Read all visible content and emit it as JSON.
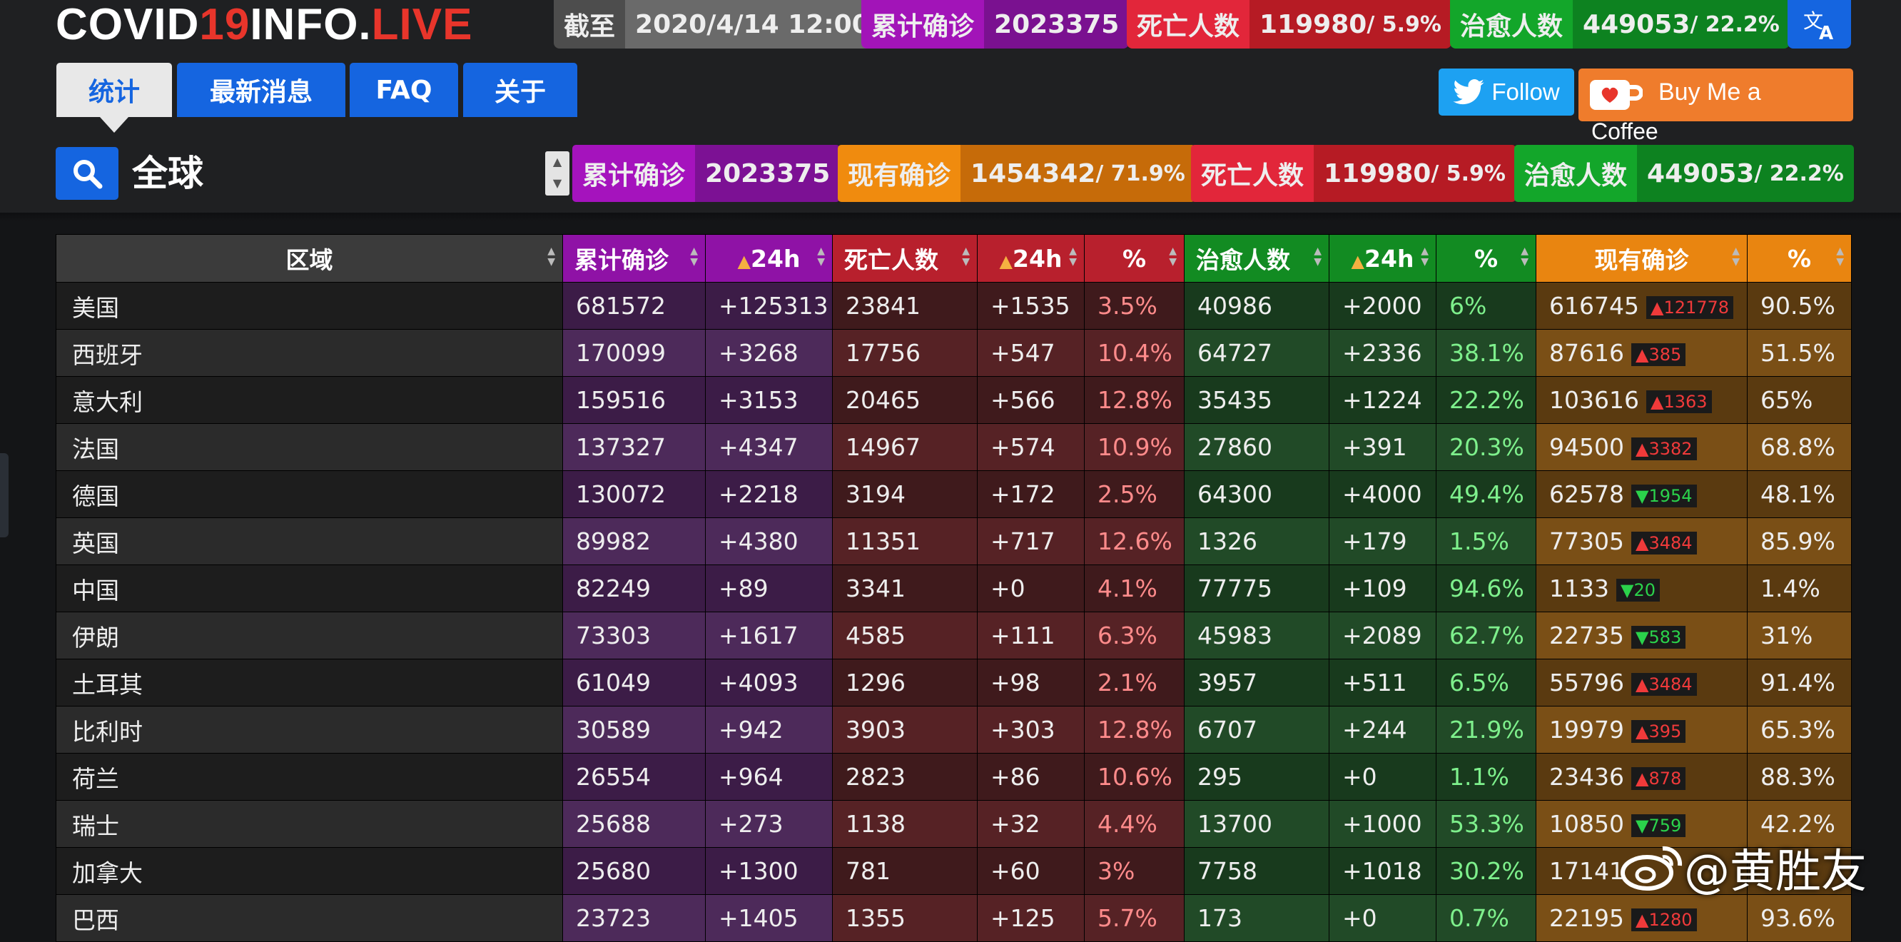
{
  "logo": {
    "part1": "COVID",
    "part2": "19",
    "part3": "INFO.",
    "part4": "LIVE"
  },
  "header_stats": {
    "asof": {
      "label": "截至",
      "value": "2020/4/14 12:00"
    },
    "confirmed": {
      "label": "累计确诊",
      "value": "2023375"
    },
    "deaths": {
      "label": "死亡人数",
      "value": "119980",
      "pct": " / 5.9%"
    },
    "recovered": {
      "label": "治愈人数",
      "value": "449053",
      "pct": " / 22.2%"
    }
  },
  "tabs": [
    "统计",
    "最新消息",
    "FAQ",
    "关于"
  ],
  "social": {
    "follow": "Follow",
    "coffee1": "Buy Me a",
    "coffee2": "Coffee"
  },
  "region": "全球",
  "summary": {
    "confirmed": {
      "label": "累计确诊",
      "value": "2023375"
    },
    "active": {
      "label": "现有确诊",
      "value": "1454342",
      "pct": " / 71.9%"
    },
    "deaths": {
      "label": "死亡人数",
      "value": "119980",
      "pct": " / 5.9%"
    },
    "recovered": {
      "label": "治愈人数",
      "value": "449053",
      "pct": " / 22.2%"
    }
  },
  "columns": [
    "区域",
    "累计确诊",
    "24h",
    "死亡人数",
    "24h",
    "%",
    "治愈人数",
    "24h",
    "%",
    "现有确诊",
    "%"
  ],
  "rows": [
    {
      "name": "美国",
      "c": "681572",
      "c24": "+125313",
      "d": "23841",
      "d24": "+1535",
      "dp": "3.5%",
      "r": "40986",
      "r24": "+2000",
      "rp": "6%",
      "a": "616745",
      "achg": "121778",
      "adir": "up",
      "ap": "90.5%"
    },
    {
      "name": "西班牙",
      "c": "170099",
      "c24": "+3268",
      "d": "17756",
      "d24": "+547",
      "dp": "10.4%",
      "r": "64727",
      "r24": "+2336",
      "rp": "38.1%",
      "a": "87616",
      "achg": "385",
      "adir": "up",
      "ap": "51.5%"
    },
    {
      "name": "意大利",
      "c": "159516",
      "c24": "+3153",
      "d": "20465",
      "d24": "+566",
      "dp": "12.8%",
      "r": "35435",
      "r24": "+1224",
      "rp": "22.2%",
      "a": "103616",
      "achg": "1363",
      "adir": "up",
      "ap": "65%"
    },
    {
      "name": "法国",
      "c": "137327",
      "c24": "+4347",
      "d": "14967",
      "d24": "+574",
      "dp": "10.9%",
      "r": "27860",
      "r24": "+391",
      "rp": "20.3%",
      "a": "94500",
      "achg": "3382",
      "adir": "up",
      "ap": "68.8%"
    },
    {
      "name": "德国",
      "c": "130072",
      "c24": "+2218",
      "d": "3194",
      "d24": "+172",
      "dp": "2.5%",
      "r": "64300",
      "r24": "+4000",
      "rp": "49.4%",
      "a": "62578",
      "achg": "1954",
      "adir": "dn",
      "ap": "48.1%"
    },
    {
      "name": "英国",
      "c": "89982",
      "c24": "+4380",
      "d": "11351",
      "d24": "+717",
      "dp": "12.6%",
      "r": "1326",
      "r24": "+179",
      "rp": "1.5%",
      "a": "77305",
      "achg": "3484",
      "adir": "up",
      "ap": "85.9%"
    },
    {
      "name": "中国",
      "c": "82249",
      "c24": "+89",
      "d": "3341",
      "d24": "+0",
      "dp": "4.1%",
      "r": "77775",
      "r24": "+109",
      "rp": "94.6%",
      "a": "1133",
      "achg": "20",
      "adir": "dn",
      "ap": "1.4%"
    },
    {
      "name": "伊朗",
      "c": "73303",
      "c24": "+1617",
      "d": "4585",
      "d24": "+111",
      "dp": "6.3%",
      "r": "45983",
      "r24": "+2089",
      "rp": "62.7%",
      "a": "22735",
      "achg": "583",
      "adir": "dn",
      "ap": "31%"
    },
    {
      "name": "土耳其",
      "c": "61049",
      "c24": "+4093",
      "d": "1296",
      "d24": "+98",
      "dp": "2.1%",
      "r": "3957",
      "r24": "+511",
      "rp": "6.5%",
      "a": "55796",
      "achg": "3484",
      "adir": "up",
      "ap": "91.4%"
    },
    {
      "name": "比利时",
      "c": "30589",
      "c24": "+942",
      "d": "3903",
      "d24": "+303",
      "dp": "12.8%",
      "r": "6707",
      "r24": "+244",
      "rp": "21.9%",
      "a": "19979",
      "achg": "395",
      "adir": "up",
      "ap": "65.3%"
    },
    {
      "name": "荷兰",
      "c": "26554",
      "c24": "+964",
      "d": "2823",
      "d24": "+86",
      "dp": "10.6%",
      "r": "295",
      "r24": "+0",
      "rp": "1.1%",
      "a": "23436",
      "achg": "878",
      "adir": "up",
      "ap": "88.3%"
    },
    {
      "name": "瑞士",
      "c": "25688",
      "c24": "+273",
      "d": "1138",
      "d24": "+32",
      "dp": "4.4%",
      "r": "13700",
      "r24": "+1000",
      "rp": "53.3%",
      "a": "10850",
      "achg": "759",
      "adir": "dn",
      "ap": "42.2%"
    },
    {
      "name": "加拿大",
      "c": "25680",
      "c24": "+1300",
      "d": "781",
      "d24": "+60",
      "dp": "3%",
      "r": "7758",
      "r24": "+1018",
      "rp": "30.2%",
      "a": "17141",
      "achg": "",
      "adir": "up",
      "ap": ""
    },
    {
      "name": "巴西",
      "c": "23723",
      "c24": "+1405",
      "d": "1355",
      "d24": "+125",
      "dp": "5.7%",
      "r": "173",
      "r24": "+0",
      "rp": "0.7%",
      "a": "22195",
      "achg": "1280",
      "adir": "up",
      "ap": "93.6%"
    }
  ],
  "watermark": "@黄胜友",
  "colors": {
    "confirmed": "#9b10b4",
    "active": "#ea7d10",
    "deaths": "#c11f1f",
    "recovered": "#0f8f24",
    "accent": "#1565e0"
  }
}
